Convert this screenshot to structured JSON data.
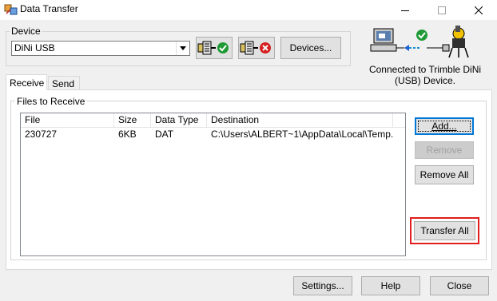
{
  "window": {
    "title": "Data Transfer",
    "icons": [
      "app-icon",
      "minimize-icon",
      "maximize-icon",
      "close-icon"
    ]
  },
  "device_group": {
    "label": "Device",
    "selected_device": "DiNi USB",
    "devices_button": "Devices...",
    "connect_icon": "connect-check-icon",
    "disconnect_icon": "disconnect-x-icon"
  },
  "status": {
    "connected_text": "Connected to Trimble DiNi (USB) Device.",
    "icon": "computer-to-level-connected-icon"
  },
  "tabs": [
    {
      "label": "Receive",
      "active": true
    },
    {
      "label": "Send",
      "active": false
    }
  ],
  "files_group": {
    "label": "Files to Receive",
    "columns": [
      "File",
      "Size",
      "Data Type",
      "Destination"
    ],
    "rows": [
      {
        "file": "230727",
        "size": "6KB",
        "data_type": "DAT",
        "destination": "C:\\Users\\ALBERT~1\\AppData\\Local\\Temp..."
      }
    ],
    "add_button": "Add...",
    "remove_button": "Remove",
    "remove_all_button": "Remove All",
    "transfer_all_button": "Transfer All"
  },
  "footer": {
    "settings_button": "Settings...",
    "help_button": "Help",
    "close_button": "Close"
  },
  "colors": {
    "highlight": "#e01e1e",
    "accent": "#0078d7",
    "check_green": "#1f9a36",
    "cross_red": "#d42020"
  }
}
